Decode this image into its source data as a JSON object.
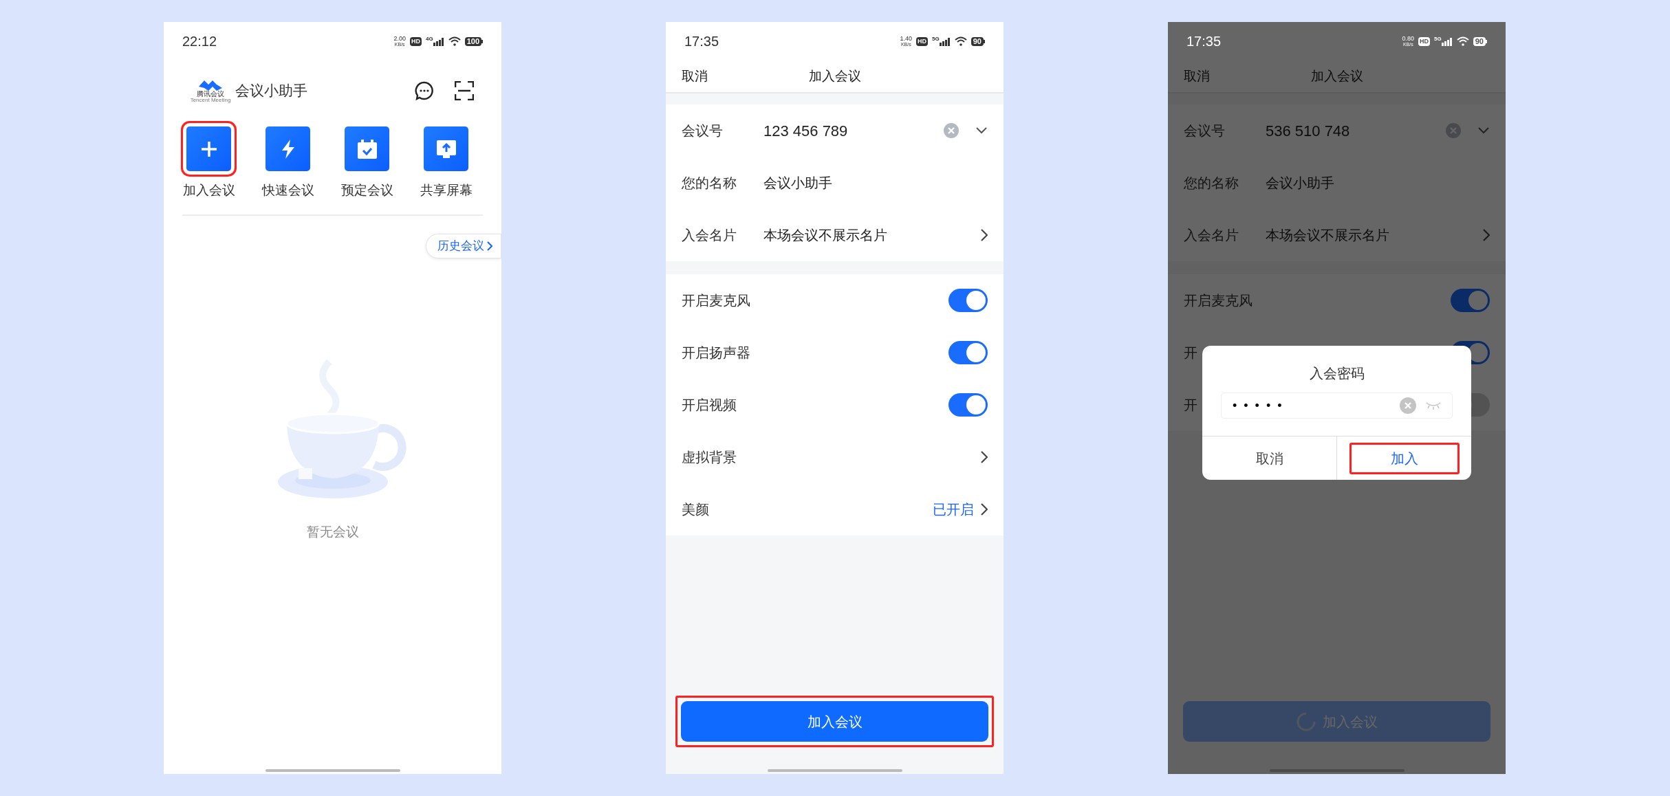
{
  "screens": [
    {
      "kind": "home",
      "status_bar": {
        "time": "22:12",
        "speed": "2.00",
        "speed_unit": "KB/s",
        "hd": "HD",
        "network": "4G",
        "battery": "100",
        "light_text": false
      },
      "logo": {
        "name": "腾讯会议",
        "subtitle": "Tencent Meeting"
      },
      "title": "会议小助手",
      "actions": [
        {
          "kind": "plus",
          "label": "加入会议",
          "highlighted": true
        },
        {
          "kind": "bolt",
          "label": "快速会议",
          "highlighted": false
        },
        {
          "kind": "calendar",
          "label": "预定会议",
          "highlighted": false
        },
        {
          "kind": "share",
          "label": "共享屏幕",
          "highlighted": false
        }
      ],
      "history_button": "历史会议",
      "empty": {
        "kind": "picture",
        "text": "暂无会议"
      }
    },
    {
      "kind": "form",
      "dimmed": false,
      "status_bar": {
        "time": "17:35",
        "speed": "1.40",
        "speed_unit": "KB/s",
        "hd": "HD",
        "network": "5G",
        "battery": "90",
        "light_text": false
      },
      "nav": {
        "cancel": "取消",
        "title": "加入会议"
      },
      "fields": [
        {
          "kind": "meeting_id",
          "label": "会议号",
          "value": "123 456 789"
        },
        {
          "kind": "text",
          "label": "您的名称",
          "value": "会议小助手"
        },
        {
          "kind": "link",
          "label": "入会名片",
          "value": "本场会议不展示名片"
        }
      ],
      "settings": [
        {
          "kind": "toggle",
          "label": "开启麦克风",
          "on": true
        },
        {
          "kind": "toggle",
          "label": "开启扬声器",
          "on": true
        },
        {
          "kind": "toggle",
          "label": "开启视频",
          "on": true
        },
        {
          "kind": "link",
          "label": "虚拟背景"
        },
        {
          "kind": "link",
          "label": "美颜",
          "value": "已开启"
        }
      ],
      "join_button": {
        "label": "加入会议",
        "disabled": false,
        "loading": false,
        "highlighted": true
      }
    },
    {
      "kind": "form",
      "dimmed": true,
      "status_bar": {
        "time": "17:35",
        "speed": "0.80",
        "speed_unit": "KB/s",
        "hd": "HD",
        "network": "5G",
        "battery": "90",
        "light_text": true
      },
      "nav": {
        "cancel": "取消",
        "title": "加入会议"
      },
      "fields": [
        {
          "kind": "meeting_id",
          "label": "会议号",
          "value": "536 510 748"
        },
        {
          "kind": "text",
          "label": "您的名称",
          "value": "会议小助手"
        },
        {
          "kind": "link",
          "label": "入会名片",
          "value": "本场会议不展示名片"
        }
      ],
      "settings": [
        {
          "kind": "toggle",
          "label": "开启麦克风",
          "on": true
        },
        {
          "kind": "toggle",
          "label": "开",
          "on": true
        },
        {
          "kind": "toggle",
          "label": "开",
          "on": false
        }
      ],
      "join_button": {
        "label": "加入会议",
        "disabled": true,
        "loading": true,
        "highlighted": false
      },
      "dialog": {
        "title": "入会密码",
        "password": "•••••",
        "buttons": [
          {
            "kind": "cancel",
            "label": "取消",
            "highlighted": false
          },
          {
            "kind": "confirm",
            "label": "加入",
            "highlighted": true
          }
        ]
      }
    }
  ]
}
